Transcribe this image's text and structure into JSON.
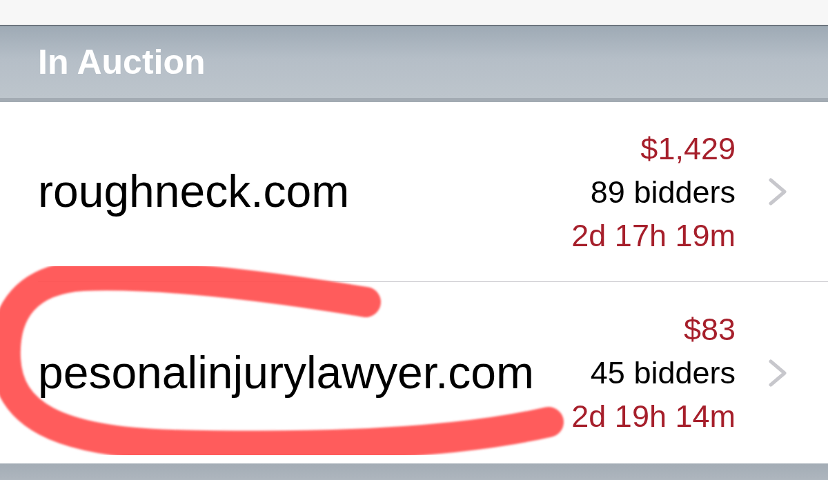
{
  "section": {
    "title": "In Auction"
  },
  "auctions": [
    {
      "domain": "roughneck.com",
      "price": "$1,429",
      "bidders": "89 bidders",
      "time_left": "2d 17h 19m"
    },
    {
      "domain": "pesonalinjurylawyer.com",
      "price": "$83",
      "bidders": "45 bidders",
      "time_left": "2d 19h 14m"
    }
  ]
}
